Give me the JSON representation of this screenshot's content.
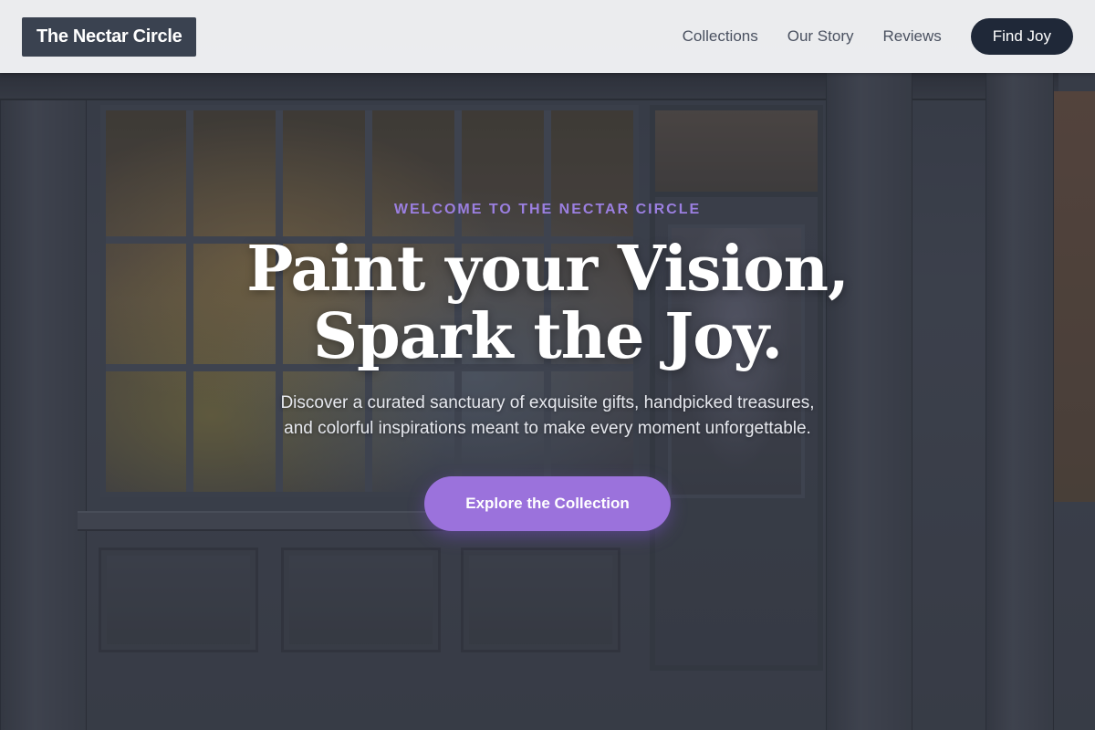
{
  "header": {
    "brand": "The Nectar Circle",
    "nav": [
      {
        "label": "Collections"
      },
      {
        "label": "Our Story"
      },
      {
        "label": "Reviews"
      }
    ],
    "cta_label": "Find Joy"
  },
  "hero": {
    "eyebrow": "WELCOME TO THE NECTAR CIRCLE",
    "headline_line1": "Paint your Vision,",
    "headline_line2": "Spark the Joy.",
    "subtext_line1": "Discover a curated sanctuary of exquisite gifts, handpicked treasures,",
    "subtext_line2": "and colorful inspirations meant to make every moment unforgettable.",
    "button_label": "Explore the Collection"
  },
  "colors": {
    "accent": "#9b72dc",
    "eyebrow": "#9b7fe0",
    "dark": "#1f2838",
    "logo_bg": "#3a4250"
  }
}
